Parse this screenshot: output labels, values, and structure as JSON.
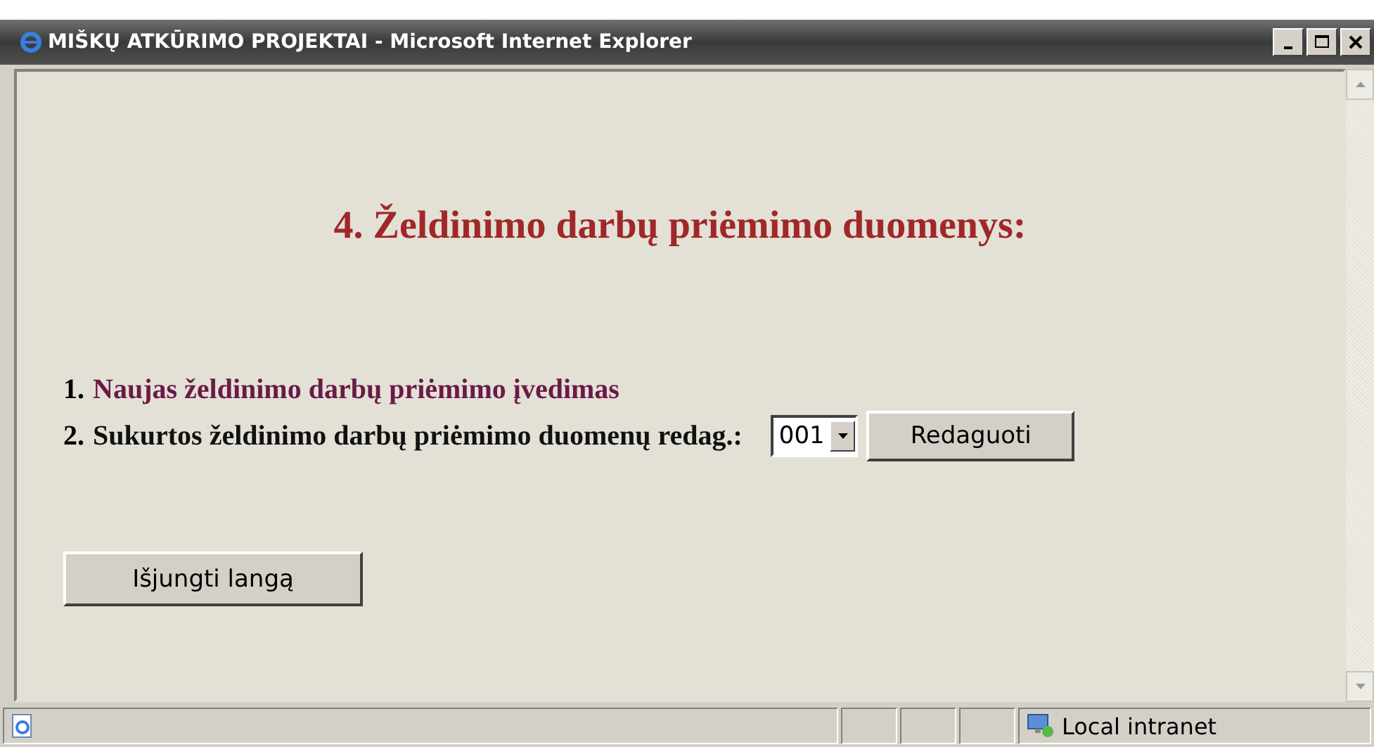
{
  "window": {
    "title": "MIŠKŲ ATKŪRIMO PROJEKTAI - Microsoft Internet Explorer"
  },
  "heading": "4. Želdinimo darbų priėmimo duomenys:",
  "items": [
    {
      "kind": "link",
      "number": "1.",
      "text": "Naujas želdinimo darbų priėmimo įvedimas"
    },
    {
      "kind": "select",
      "number": "2.",
      "text": "Sukurtos želdinimo darbų priėmimo duomenų redag.:",
      "value": "001",
      "button": "Redaguoti"
    }
  ],
  "close_button": "Išjungti langą",
  "status_bar": {
    "zone": "Local intranet"
  }
}
